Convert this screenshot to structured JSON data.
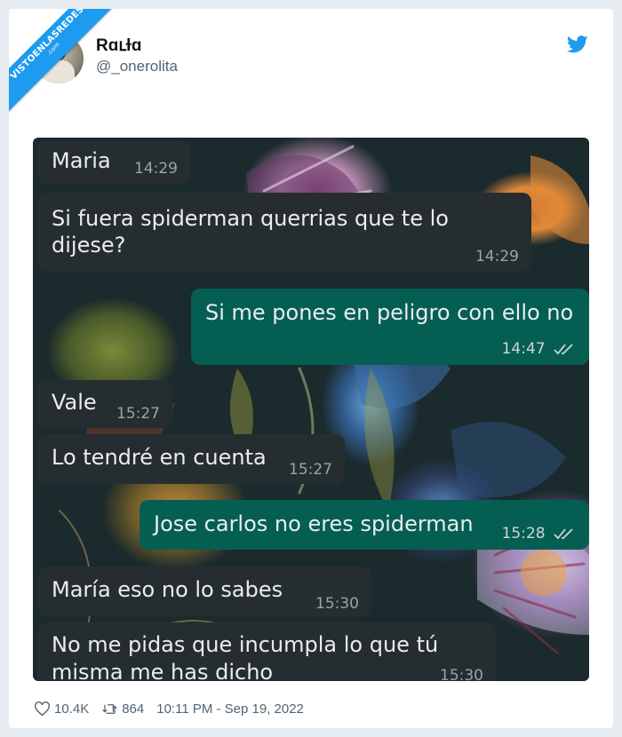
{
  "watermark": {
    "line1": "VISTOENLASREDES",
    "line2": ".com"
  },
  "tweet": {
    "display_name": "Rɑւɫɑ",
    "handle": "@_onerolita",
    "likes": "10.4K",
    "retweets": "864",
    "timestamp": "10:11 PM - Sep 19, 2022"
  },
  "colors": {
    "accent": "#1d9bf0",
    "bubble_in": "#262d31",
    "bubble_out": "#055e52"
  },
  "chat": {
    "messages": [
      {
        "text": "Maria",
        "time": "14:29",
        "direction": "in"
      },
      {
        "text": "Si fuera spiderman querrias que te lo",
        "text2": "dijese?",
        "time": "14:29",
        "direction": "in"
      },
      {
        "text": "Si me pones en peligro con ello no",
        "time": "14:47",
        "direction": "out"
      },
      {
        "text": "Vale",
        "time": "15:27",
        "direction": "in"
      },
      {
        "text": "Lo tendré en cuenta",
        "time": "15:27",
        "direction": "in"
      },
      {
        "text": "Jose carlos no eres spiderman",
        "time": "15:28",
        "direction": "out"
      },
      {
        "text": "María eso no lo sabes",
        "time": "15:30",
        "direction": "in"
      },
      {
        "text": "No me pidas que incumpla lo que tú",
        "text2": "misma me has dicho",
        "time": "15:30",
        "direction": "in"
      }
    ]
  }
}
